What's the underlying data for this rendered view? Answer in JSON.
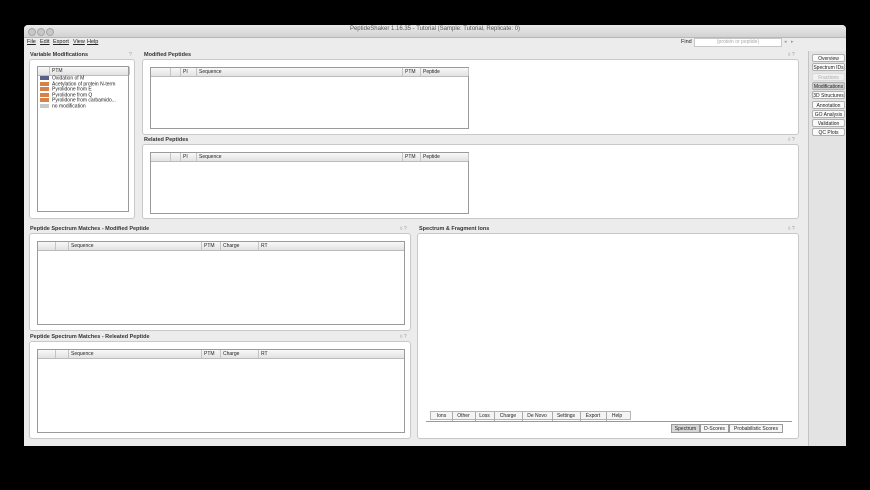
{
  "window": {
    "title": "PeptideShaker 1.16.35 - Tutorial (Sample: Tutorial, Replicate: 0)"
  },
  "menu": {
    "items": [
      "File",
      "Edit",
      "Export",
      "View",
      "Help"
    ]
  },
  "find": {
    "label": "Find",
    "placeholder": "(protein or peptide)",
    "prev_arrow": "◂",
    "next_arrow": "▸"
  },
  "help_mark": "?",
  "panel_nav_glyph": "◊",
  "variable_modifications": {
    "title": "Variable Modifications",
    "column": "PTM",
    "items": [
      {
        "label": "Oxidation of M",
        "color": "#5a5f8a"
      },
      {
        "label": "Acetylation of protein N-term",
        "color": "#d9804a"
      },
      {
        "label": "Pyrolidone from E",
        "color": "#d9804a"
      },
      {
        "label": "Pyrolidone from Q",
        "color": "#d9804a"
      },
      {
        "label": "Pyrolidone from carbamido...",
        "color": "#d9804a"
      },
      {
        "label": "no modification",
        "color": "#c8c8c8"
      }
    ]
  },
  "modified_peptides": {
    "title": "Modified Peptides",
    "columns": [
      "",
      "",
      "PI",
      "Sequence",
      "PTM",
      "Peptide"
    ]
  },
  "related_peptides": {
    "title": "Related Peptides",
    "columns": [
      "",
      "",
      "PI",
      "Sequence",
      "PTM",
      "Peptide"
    ]
  },
  "psm_modified": {
    "title": "Peptide Spectrum Matches - Modified Peptide",
    "columns": [
      "",
      "",
      "Sequence",
      "PTM",
      "Charge",
      "RT"
    ]
  },
  "psm_related": {
    "title": "Peptide Spectrum Matches - Releated Peptide",
    "columns": [
      "",
      "",
      "Sequence",
      "PTM",
      "Charge",
      "RT"
    ]
  },
  "spectrum": {
    "title": "Spectrum & Fragment Ions",
    "tabs": [
      "Ions",
      "Other",
      "Loss",
      "Charge",
      "De Novo",
      "Settings",
      "Export",
      "Help"
    ],
    "bottom_tabs": [
      "Spectrum",
      "D-Scores",
      "Probabilistic Scores"
    ],
    "selected_bottom_tab": "Spectrum"
  },
  "sidebar": {
    "items": [
      "Overview",
      "Spectrum IDs",
      "Fractions",
      "Modifications",
      "3D Structures",
      "Annotation",
      "GO Analysis",
      "Validation",
      "QC Plots"
    ],
    "selected": "Modifications",
    "disabled": [
      "Fractions"
    ]
  }
}
